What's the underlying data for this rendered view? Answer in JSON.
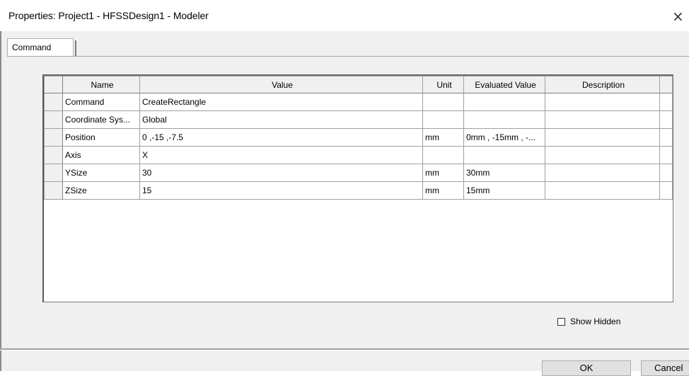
{
  "window": {
    "title": "Properties: Project1 - HFSSDesign1 - Modeler",
    "close_glyph": "×"
  },
  "tabs": [
    {
      "label": "Command"
    }
  ],
  "grid": {
    "columns": [
      "Name",
      "Value",
      "Unit",
      "Evaluated Value",
      "Description"
    ],
    "rows": [
      {
        "name": "Command",
        "value": "CreateRectangle",
        "unit": "",
        "evaluated": "",
        "description": ""
      },
      {
        "name": "Coordinate Sys...",
        "value": "Global",
        "unit": "",
        "evaluated": "",
        "description": ""
      },
      {
        "name": "Position",
        "value": "0 ,-15 ,-7.5",
        "unit": "mm",
        "evaluated": "0mm , -15mm , -...",
        "description": ""
      },
      {
        "name": "Axis",
        "value": "X",
        "unit": "",
        "evaluated": "",
        "description": ""
      },
      {
        "name": "YSize",
        "value": "30",
        "unit": "mm",
        "evaluated": "30mm",
        "description": ""
      },
      {
        "name": "ZSize",
        "value": "15",
        "unit": "mm",
        "evaluated": "15mm",
        "description": ""
      }
    ]
  },
  "show_hidden": {
    "label": "Show Hidden",
    "checked": false
  },
  "buttons": {
    "ok": "OK",
    "cancel": "Cancel"
  }
}
